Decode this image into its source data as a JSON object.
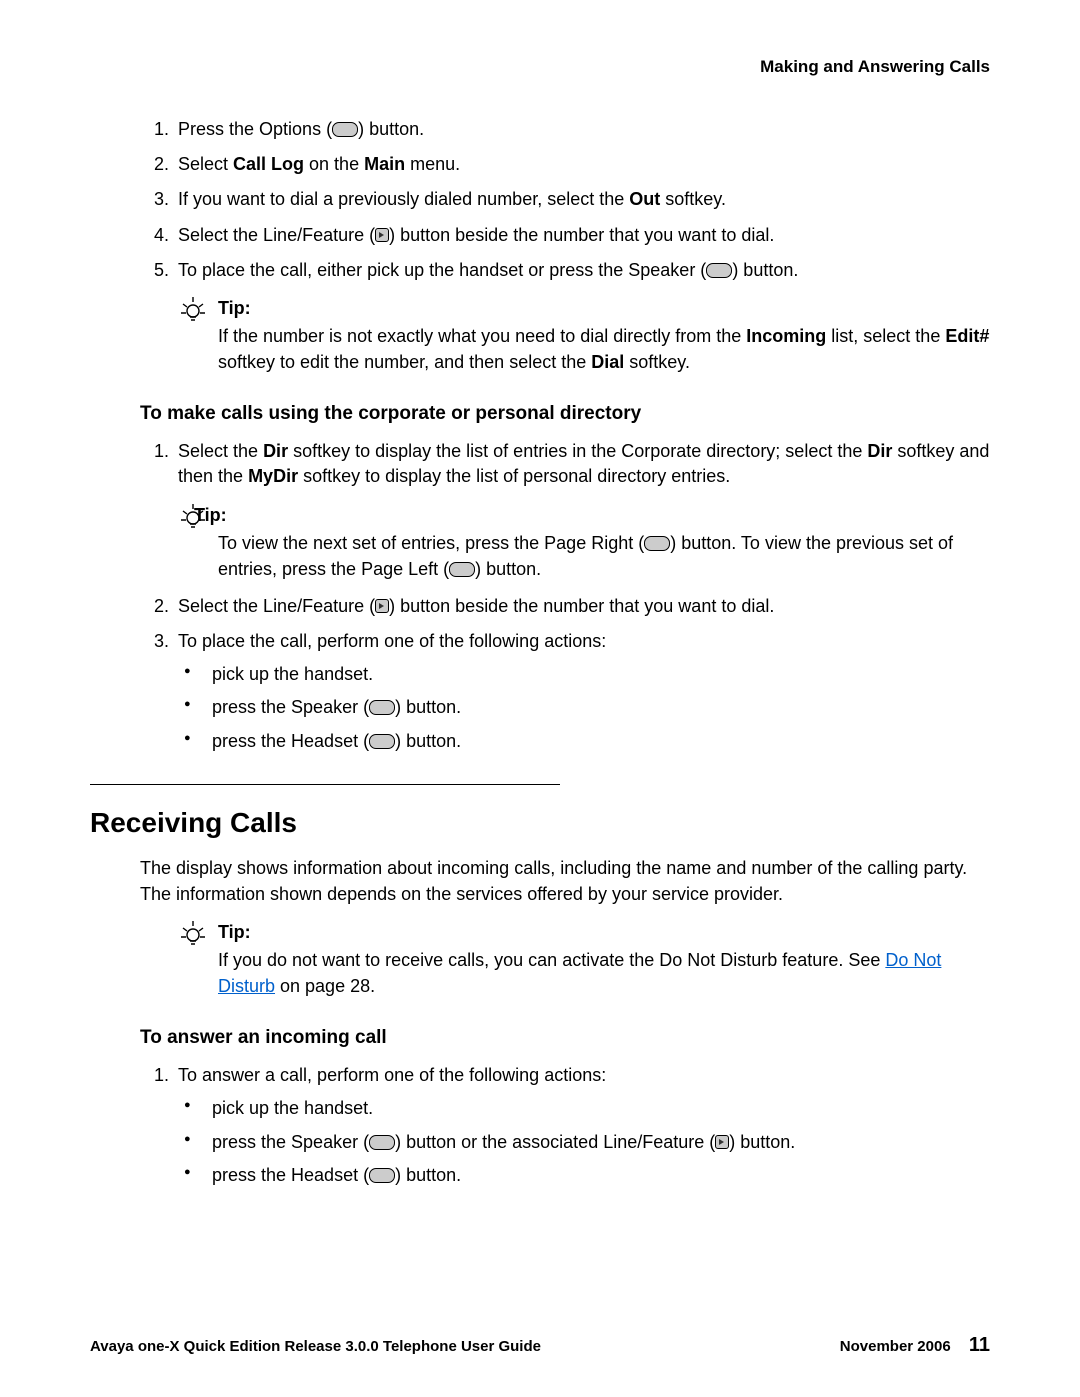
{
  "header": {
    "title": "Making and Answering Calls"
  },
  "steps1": {
    "s1a": "Press the Options (",
    "s1b": ") button.",
    "s2a": "Select ",
    "s2b": "Call Log",
    "s2c": " on the ",
    "s2d": "Main",
    "s2e": " menu.",
    "s3a": "If you want to dial a previously dialed number, select the ",
    "s3b": "Out",
    "s3c": " softkey.",
    "s4a": "Select the Line/Feature (",
    "s4b": ") button beside the number that you want to dial.",
    "s5a": "To place the call, either pick up the handset or press the Speaker (",
    "s5b": ") button."
  },
  "tip1": {
    "label": "Tip:",
    "t1": "If the number is not exactly what you need to dial directly from the ",
    "t2": "Incoming",
    "t3": " list, select the ",
    "t4": "Edit#",
    "t5": " softkey to edit the number, and then select the ",
    "t6": "Dial",
    "t7": " softkey."
  },
  "sectionA": {
    "heading": "To make calls using the corporate or personal directory"
  },
  "dirSteps": {
    "s1a": "Select the ",
    "s1b": "Dir",
    "s1c": " softkey to display the list of entries in the Corporate directory; select the ",
    "s1d": "Dir",
    "s1e": " softkey and then the ",
    "s1f": "MyDir",
    "s1g": " softkey to display the list of personal directory entries.",
    "s2a": "Select the Line/Feature (",
    "s2b": ") button beside the number that you want to dial.",
    "s3": "To place the call, perform one of the following actions:"
  },
  "tip2": {
    "label": "Tip:",
    "t1": "To view the next set of entries, press the Page Right (",
    "t2": ") button. To view the previous set of entries, press the Page Left (",
    "t3": ") button."
  },
  "bullets1": {
    "b1": "pick up the handset.",
    "b2a": "press the Speaker (",
    "b2b": ") button.",
    "b3a": "press the Headset (",
    "b3b": ") button."
  },
  "sectionB": {
    "heading": "Receiving Calls"
  },
  "recvIntro": "The display shows information about incoming calls, including the name and number of the calling party. The information shown depends on the services offered by your service provider.",
  "tip3": {
    "label": "Tip:",
    "t1": "If you do not want to receive calls, you can activate the Do Not Disturb feature. See ",
    "link": "Do Not Disturb",
    "t2": " on page 28."
  },
  "sectionC": {
    "heading": "To answer an incoming call"
  },
  "ansSteps": {
    "s1": "To answer a call, perform one of the following actions:"
  },
  "bullets2": {
    "b1": "pick up the handset.",
    "b2a": "press the Speaker (",
    "b2b": ") button or the associated Line/Feature (",
    "b2c": ") button.",
    "b3a": "press the Headset (",
    "b3b": ") button."
  },
  "footer": {
    "left": "Avaya one-X Quick Edition Release 3.0.0 Telephone User Guide",
    "date": "November 2006",
    "page": "11"
  }
}
